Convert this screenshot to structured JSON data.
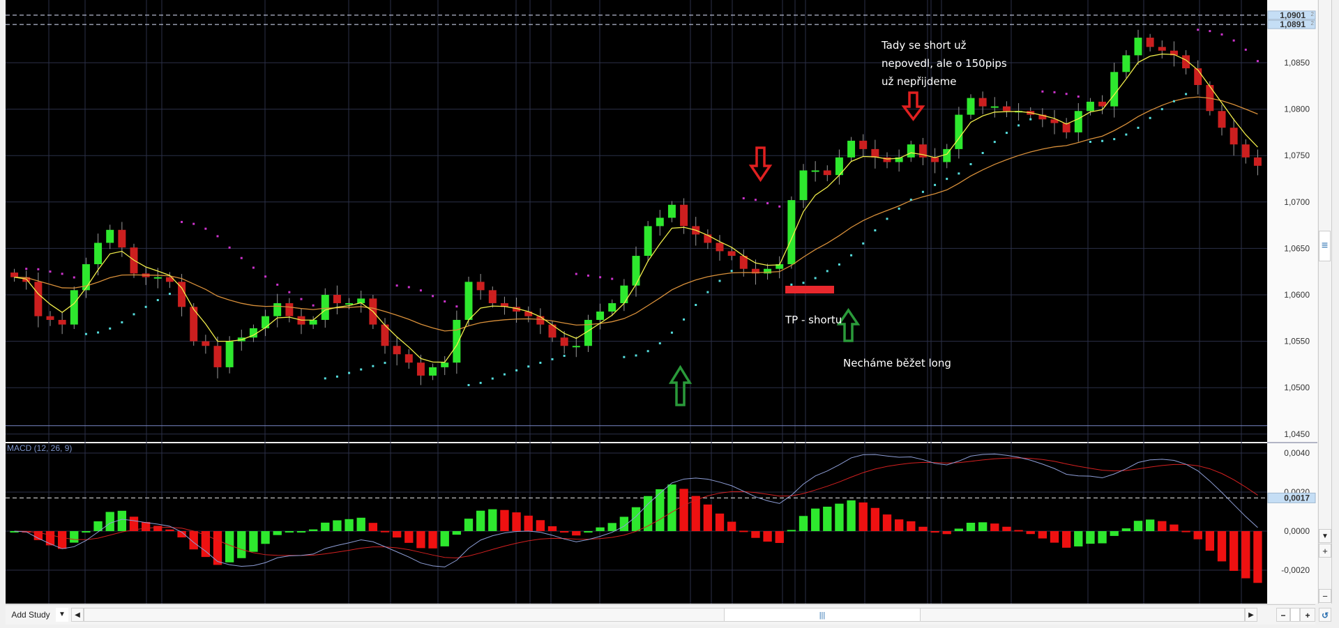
{
  "chart_data": {
    "type": "candlestick",
    "instrument_pane": {
      "closes": [
        1.0619,
        1.0614,
        1.0577,
        1.0573,
        1.0568,
        1.0605,
        1.0633,
        1.0656,
        1.067,
        1.0651,
        1.0623,
        1.0619,
        1.0619,
        1.0614,
        1.0587,
        1.055,
        1.0545,
        1.0522,
        1.055,
        1.0554,
        1.0564,
        1.0577,
        1.0591,
        1.0577,
        1.0568,
        1.0573,
        1.06,
        1.0591,
        1.0591,
        1.0596,
        1.0568,
        1.0545,
        1.0536,
        1.0527,
        1.0513,
        1.0522,
        1.0527,
        1.0573,
        1.0614,
        1.0605,
        1.0591,
        1.0587,
        1.0582,
        1.0577,
        1.0568,
        1.0554,
        1.0545,
        1.0545,
        1.0573,
        1.0582,
        1.0591,
        1.061,
        1.0642,
        1.0674,
        1.0683,
        1.0697,
        1.0674,
        1.0665,
        1.0656,
        1.0647,
        1.0642,
        1.0628,
        1.0623,
        1.0628,
        1.0633,
        1.0702,
        1.0734,
        1.0734,
        1.0729,
        1.0748,
        1.0766,
        1.0757,
        1.0748,
        1.0743,
        1.0748,
        1.0762,
        1.0748,
        1.0743,
        1.0757,
        1.0794,
        1.0812,
        1.0803,
        1.0803,
        1.0798,
        1.0798,
        1.0794,
        1.0789,
        1.0785,
        1.0775,
        1.0798,
        1.0808,
        1.0803,
        1.084,
        1.0858,
        1.0877,
        1.0867,
        1.0863,
        1.0858,
        1.0844,
        1.0826,
        1.0798,
        1.078,
        1.0762,
        1.0748,
        1.0739
      ],
      "indicators": [
        "fast moving average (yellow)",
        "slow moving average (orange)",
        "parabolic SAR (dots)"
      ],
      "ylim": [
        1.045,
        1.0905
      ],
      "yticks": [
        "1,0850",
        "1,0800",
        "1,0750",
        "1,0700",
        "1,0650",
        "1,0600",
        "1,0550",
        "1,0500",
        "1,0450"
      ],
      "ytick_values": [
        1.085,
        1.08,
        1.075,
        1.07,
        1.065,
        1.06,
        1.055,
        1.05,
        1.045
      ],
      "price_markers": [
        {
          "main": "1,0901",
          "sup": "2",
          "value": 1.09012
        },
        {
          "main": "1,0891",
          "sup": "2",
          "value": 1.08912
        }
      ],
      "horizontal_line": 1.0459
    },
    "macd_pane": {
      "title": "MACD (12, 26, 9)",
      "fast": 12,
      "slow": 26,
      "signal": 9,
      "ylim": [
        -0.0035,
        0.0045
      ],
      "yticks": [
        "0,0040",
        "0,0020",
        "0,0000",
        "-0,0020"
      ],
      "ytick_values": [
        0.004,
        0.002,
        0,
        -0.002
      ],
      "marker": {
        "label": "0,0017",
        "value": 0.0017
      }
    },
    "annotations": {
      "short_fail": [
        "Tady se short už",
        "nepovedl, ale o 150pips",
        "už nepřijdeme"
      ],
      "take_profit": "TP - shortu",
      "let_long_run": "Necháme běžet long"
    },
    "colors": {
      "up": "#2ee82e",
      "down": "#cc1f1f",
      "fast_ma": "#f2ee4a",
      "slow_ma": "#d9903a",
      "sar_below": "#55dddd",
      "sar_above": "#cc33cc",
      "macd": "#8f9fd8",
      "signal": "#d42020",
      "grid": "#2b3048"
    }
  },
  "toolbar": {
    "add_study": "Add Study",
    "dropdown_icon": "▼",
    "scroll_left": "◀",
    "scroll_right": "▶",
    "thumb_grip": "|||",
    "zoom_out": "−",
    "zoom_in": "+",
    "reset": "↺"
  },
  "right_scroll": {
    "grip": "≡",
    "down": "▼",
    "plus": "+",
    "minus": "−"
  }
}
